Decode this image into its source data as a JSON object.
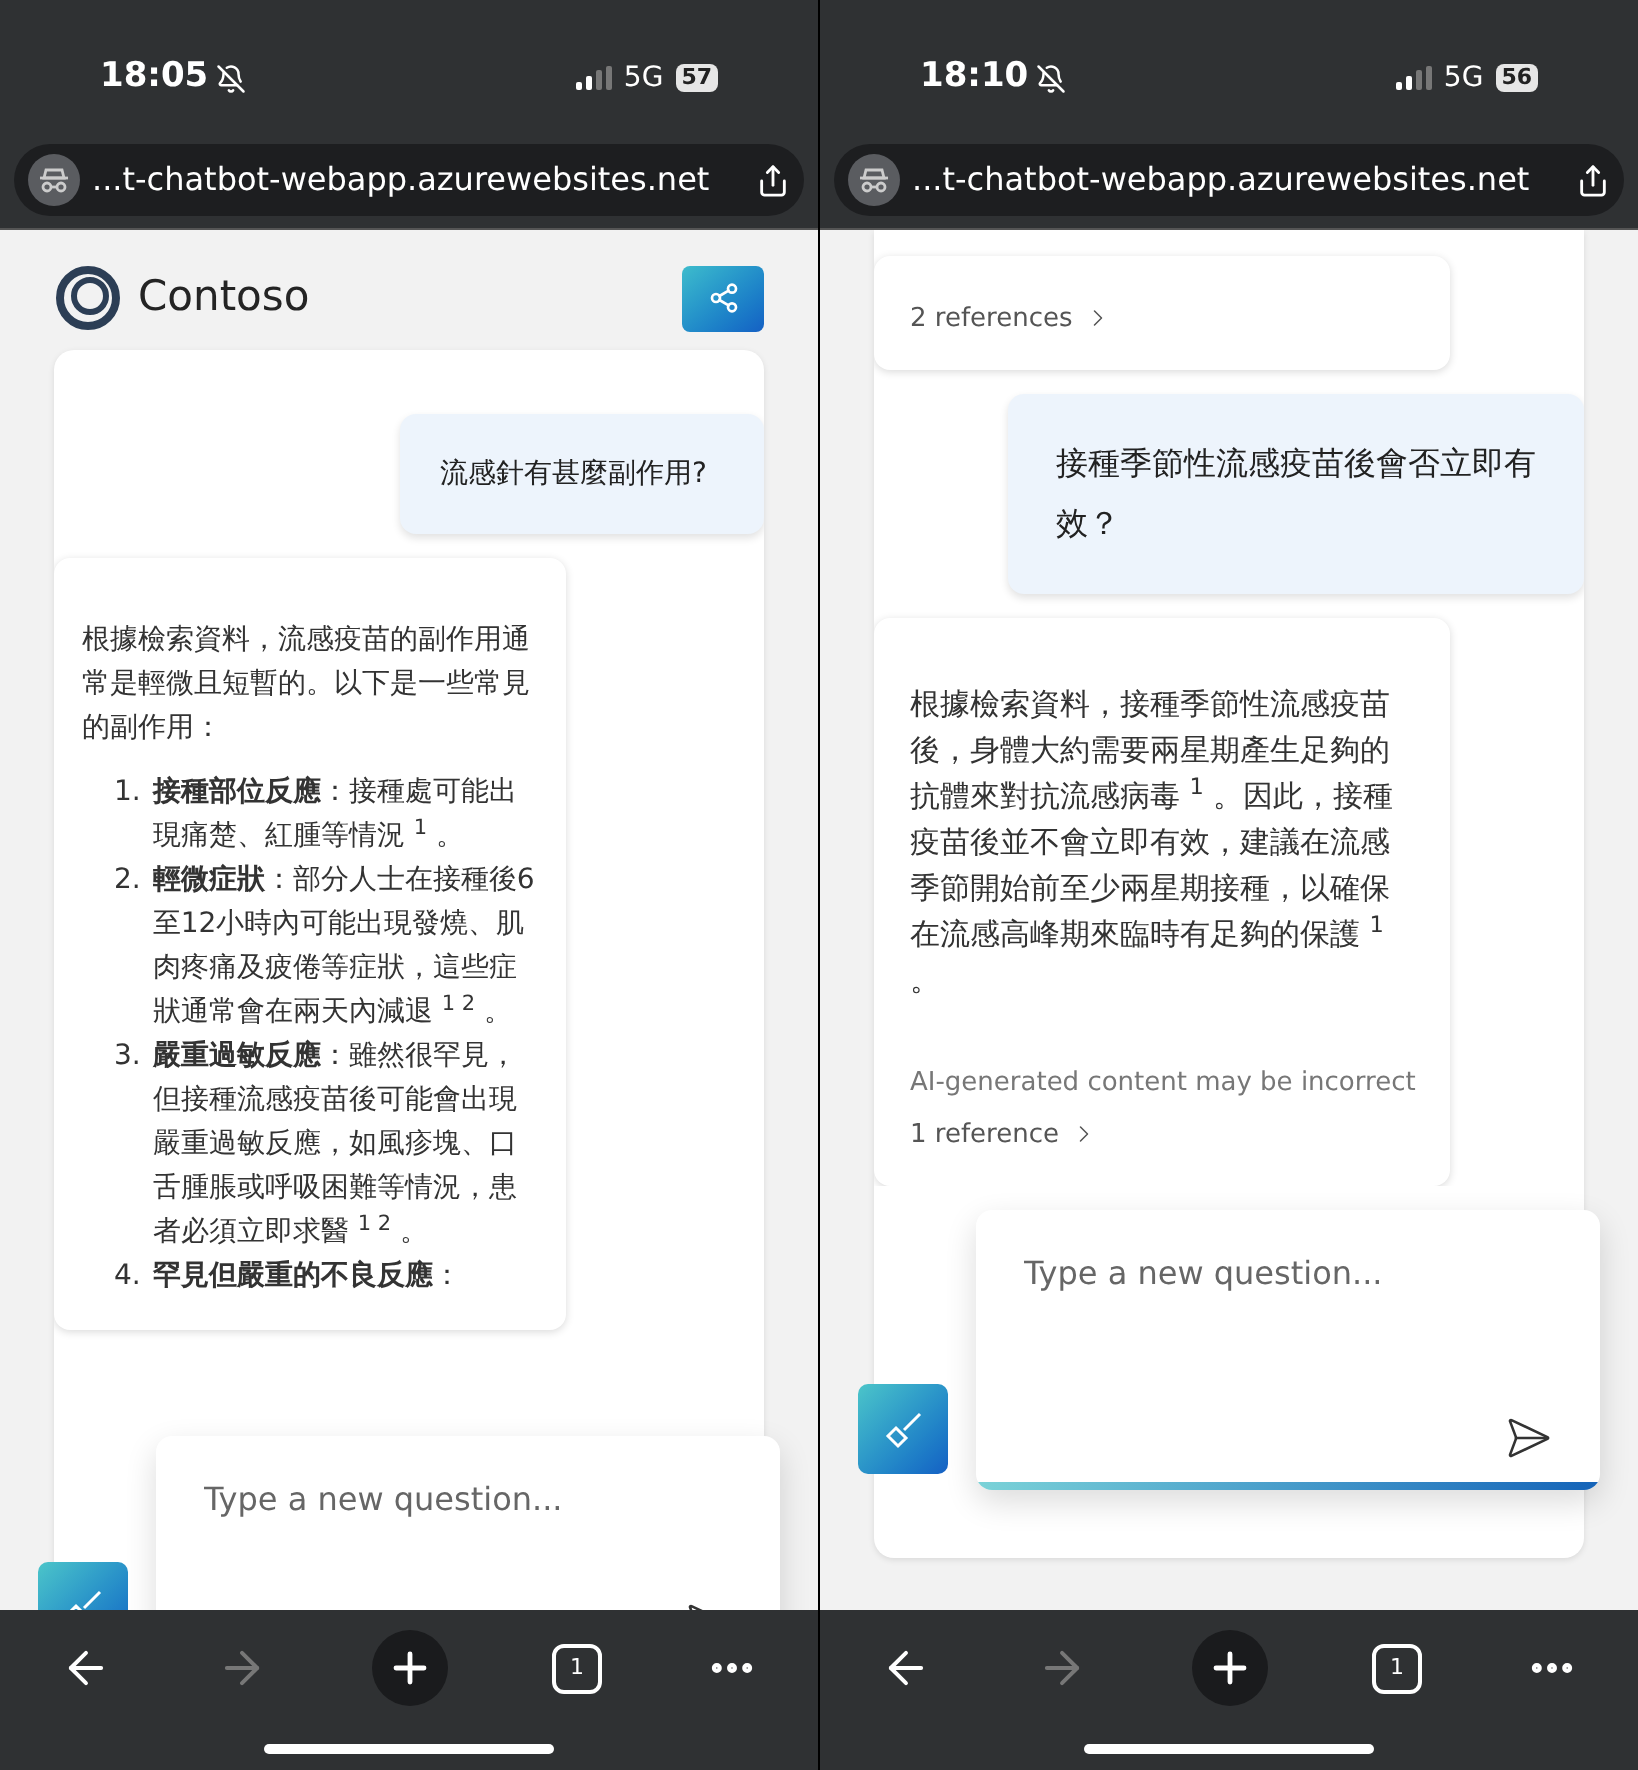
{
  "phones": [
    {
      "status": {
        "time": "18:05",
        "network": "5G",
        "battery": "57"
      },
      "url": "...t-chatbot-webapp.azurewebsites.net",
      "header": {
        "brand": "Contoso"
      },
      "messages": [
        {
          "kind": "user",
          "text": "流感針有甚麼副作用?"
        },
        {
          "kind": "assistant",
          "text": "根據檢索資料，流感疫苗的副作用通常是輕微且短暫的。以下是一些常見的副作用：",
          "list": [
            {
              "number": "1.",
              "text": "**接種部位反應**：接種處可能出現痛楚、紅腫等情況 $^{1}$ 。"
            },
            {
              "number": "2.",
              "text": "**輕微症狀**：部分人士在接種後6至12小時內可能出現發燒、肌肉疼痛及疲倦等症狀，這些症狀通常會在兩天內減退 $^{1 2}$ 。"
            },
            {
              "number": "3.",
              "text": "**嚴重過敏反應**：雖然很罕見，但接種流感疫苗後可能會出現嚴重過敏反應，如風疹塊、口舌腫脹或呼吸困難等情況，患者必須立即求醫 $^{1 2}$ 。"
            },
            {
              "number": "4.",
              "text": "**罕見但嚴重的不良反應**："
            }
          ]
        }
      ],
      "composer": {
        "placeholder": "Type a new question..."
      },
      "toolbar": {
        "tab_count": "1",
        "forward_disabled": true
      }
    },
    {
      "status": {
        "time": "18:10",
        "network": "5G",
        "battery": "56"
      },
      "url": "...t-chatbot-webapp.azurewebsites.net",
      "messages": [
        {
          "kind": "assistant",
          "references": "2 references"
        },
        {
          "kind": "user",
          "text": "接種季節性流感疫苗後會否立即有效？"
        },
        {
          "kind": "assistant",
          "text": "根據檢索資料，接種季節性流感疫苗後，身體大約需要兩星期產生足夠的抗體來對抗流感病毒 $^{1}$ 。因此，接種疫苗後並不會立即有效，建議在流感季節開始前至少兩星期接種，以確保在流感高峰期來臨時有足夠的保護 $^{1}$ 。",
          "disclaimer": "AI-generated content may be incorrect",
          "references": "1 reference"
        }
      ],
      "composer": {
        "placeholder": "Type a new question..."
      },
      "toolbar": {
        "tab_count": "1",
        "forward_disabled": true
      }
    }
  ]
}
